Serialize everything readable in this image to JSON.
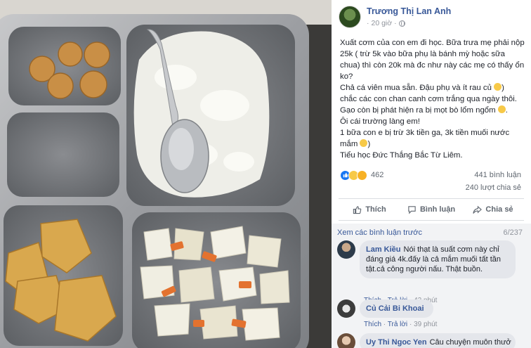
{
  "post": {
    "author": "Trương Thị Lan Anh",
    "time": "20 giờ",
    "dot": "·",
    "text_lines": [
      "Xuất cơm của con em đi học. Bữa trưa mẹ phải nộp 25k ( trừ 5k vào bữa phụ là bánh mỳ hoặc sữa chua) thì còn 20k mà đc như này các mẹ có thấy ổn ko?",
      "Chả cá viên mua sẵn. Đậu phụ và ít rau củ",
      "chắc các con chan canh cơm trắng qua ngày thôi.",
      "Gạo còn bị phát hiện ra bị mọt bò lổm ngổm",
      "Ôi cái trường làng em!",
      "1 bữa con e bị trừ 3k tiền ga, 3k tiền muối nước mắm",
      "Tiểu học Đức Thắng Bắc Từ Liêm."
    ],
    "reaction_count": "462",
    "comment_count": "441 bình luận",
    "share_count": "240 lượt chia sẻ",
    "actions": {
      "like": "Thích",
      "comment": "Bình luận",
      "share": "Chia sẻ"
    }
  },
  "comments": {
    "previous_link": "Xem các bình luận trước",
    "page_count": "6/237",
    "items": [
      {
        "name": "Lam Kiều",
        "text": "Nói thạt là suất cơm này chỉ đáng giá 4k.đấy là cả mắm muối tất tần tật.cả công người nấu. Thật buồn.",
        "like": "Thích",
        "reply": "Trả lời",
        "time": "42 phút",
        "sep": "·"
      },
      {
        "name": "Củ Cải Bi Khoai",
        "text": "",
        "like": "Thích",
        "reply": "Trả lời",
        "time": "39 phút",
        "sep": "·"
      },
      {
        "name": "Uy Thi Ngoc Yen",
        "text": "Câu chuyện muôn thưở"
      }
    ]
  },
  "colors": {
    "link": "#385898",
    "secondary": "#606770",
    "comment_bg": "#f2f3f5",
    "bubble": "#e4e6eb"
  }
}
